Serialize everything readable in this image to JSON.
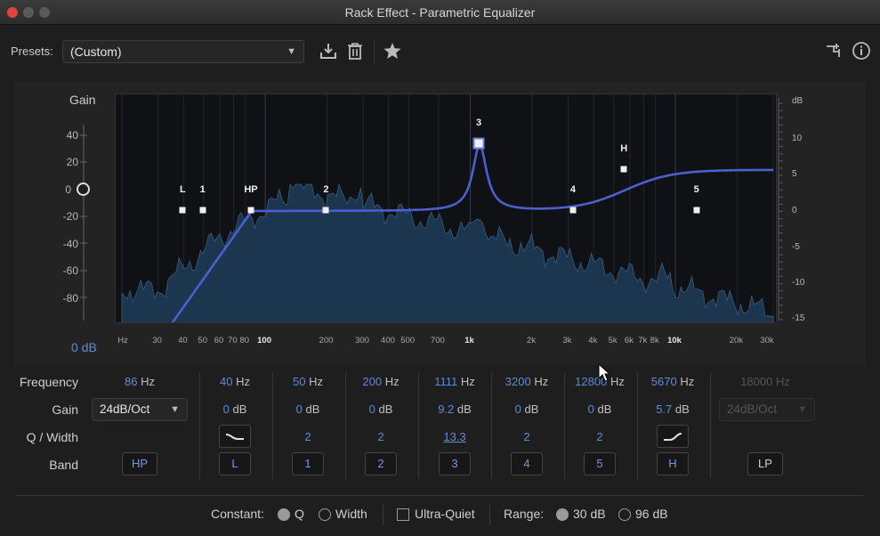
{
  "window": {
    "title": "Rack Effect - Parametric Equalizer"
  },
  "presets": {
    "label": "Presets:",
    "value": "(Custom)"
  },
  "graph": {
    "gain_label": "Gain",
    "gain_ticks": [
      "40",
      "20",
      "0",
      "-20",
      "-40",
      "-60",
      "-80"
    ],
    "db_readout": "0 dB",
    "db_label": "dB",
    "db_ticks": [
      "10",
      "5",
      "0",
      "-5",
      "-10",
      "-15"
    ],
    "freq_ticks": [
      {
        "f": 20,
        "t": "Hz"
      },
      {
        "f": 30,
        "t": "30"
      },
      {
        "f": 40,
        "t": "40"
      },
      {
        "f": 50,
        "t": "50"
      },
      {
        "f": 60,
        "t": "60"
      },
      {
        "f": 70,
        "t": "70"
      },
      {
        "f": 80,
        "t": "80"
      },
      {
        "f": 100,
        "t": "100"
      },
      {
        "f": 200,
        "t": "200"
      },
      {
        "f": 300,
        "t": "300"
      },
      {
        "f": 400,
        "t": "400"
      },
      {
        "f": 500,
        "t": "500"
      },
      {
        "f": 700,
        "t": "700"
      },
      {
        "f": 1000,
        "t": "1k"
      },
      {
        "f": 2000,
        "t": "2k"
      },
      {
        "f": 3000,
        "t": "3k"
      },
      {
        "f": 4000,
        "t": "4k"
      },
      {
        "f": 5000,
        "t": "5k"
      },
      {
        "f": 6000,
        "t": "6k"
      },
      {
        "f": 7000,
        "t": "7k"
      },
      {
        "f": 8000,
        "t": "8k"
      },
      {
        "f": 10000,
        "t": "10k"
      },
      {
        "f": 20000,
        "t": "20k"
      },
      {
        "f": 30000,
        "t": "30k"
      }
    ],
    "nodes": [
      {
        "label": "L",
        "freq": 40,
        "gain": 0
      },
      {
        "label": "1",
        "freq": 50,
        "gain": 0
      },
      {
        "label": "HP",
        "freq": 86,
        "gain": 0
      },
      {
        "label": "2",
        "freq": 200,
        "gain": 0
      },
      {
        "label": "3",
        "freq": 1111,
        "gain": 9.2
      },
      {
        "label": "4",
        "freq": 3200,
        "gain": 0
      },
      {
        "label": "H",
        "freq": 5670,
        "gain": 5.7
      },
      {
        "label": "5",
        "freq": 12800,
        "gain": 0
      }
    ]
  },
  "controls": {
    "frequency_label": "Frequency",
    "gain_label": "Gain",
    "q_label": "Q / Width",
    "band_label": "Band",
    "hp_slope": "24dB/Oct",
    "lp_slope": "24dB/Oct",
    "bands": [
      {
        "band": "HP",
        "freq": "86",
        "unit": "Hz"
      },
      {
        "band": "L",
        "freq": "40",
        "unit": "Hz",
        "gain": "0",
        "shape": "low-shelf-icon"
      },
      {
        "band": "1",
        "freq": "50",
        "unit": "Hz",
        "gain": "0",
        "q": "2"
      },
      {
        "band": "2",
        "freq": "200",
        "unit": "Hz",
        "gain": "0",
        "q": "2"
      },
      {
        "band": "3",
        "freq": "1111",
        "unit": "Hz",
        "gain": "9.2",
        "q": "13.3"
      },
      {
        "band": "4",
        "freq": "3200",
        "unit": "Hz",
        "gain": "0",
        "q": "2"
      },
      {
        "band": "5",
        "freq": "12800",
        "unit": "Hz",
        "gain": "0",
        "q": "2"
      },
      {
        "band": "H",
        "freq": "5670",
        "unit": "Hz",
        "gain": "5.7",
        "shape": "high-shelf-icon"
      },
      {
        "band": "LP",
        "freq": "18000",
        "unit": "Hz"
      }
    ],
    "db_unit": "dB"
  },
  "footer": {
    "constant_label": "Constant:",
    "q_option": "Q",
    "width_option": "Width",
    "ultra_quiet": "Ultra-Quiet",
    "range_label": "Range:",
    "range_30": "30 dB",
    "range_96": "96 dB"
  },
  "colors": {
    "curve": "#4b5fd0",
    "spectrum": "#1e3a55",
    "accent": "#5d8bd8"
  }
}
